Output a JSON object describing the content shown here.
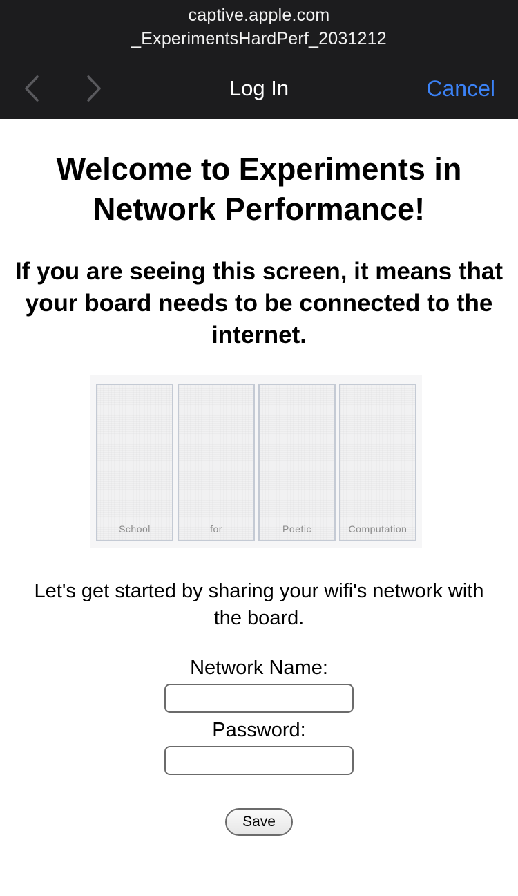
{
  "header": {
    "url_host": "captive.apple.com",
    "network_ssid": "_ExperimentsHardPerf_2031212",
    "title": "Log In",
    "cancel_label": "Cancel",
    "back_icon": "chevron-left-icon",
    "forward_icon": "chevron-right-icon",
    "accent_color": "#3b82f6",
    "background_color": "#1c1c1e"
  },
  "page": {
    "heading": "Welcome to Experiments in Network Performance!",
    "subheading": "If you are seeing this screen, it means that your board needs to be connected to the internet.",
    "board_image": {
      "panels": [
        "School",
        "for",
        "Poetic",
        "Computation"
      ]
    },
    "instructions": "Let's get started by sharing your wifi's network with the board.",
    "form": {
      "network_label": "Network Name:",
      "network_value": "",
      "password_label": "Password:",
      "password_value": "",
      "save_label": "Save"
    }
  }
}
